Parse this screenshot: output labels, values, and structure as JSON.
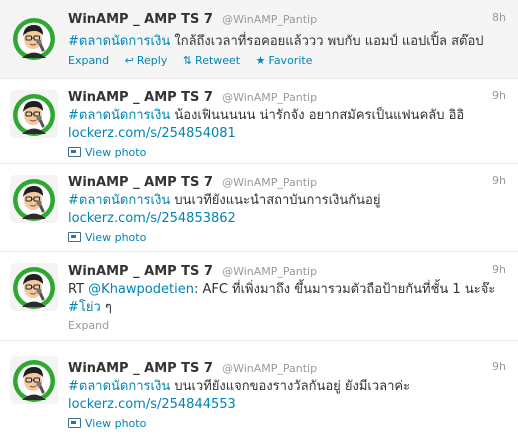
{
  "colors": {
    "link": "#0084b4",
    "muted": "#999999",
    "text": "#333333",
    "avatar_ring": "#2fa833"
  },
  "actions": {
    "expand": "Expand",
    "reply": "Reply",
    "retweet": "Retweet",
    "favorite": "Favorite",
    "view_photo": "View photo",
    "reply_icon": "reply-arrow-icon",
    "retweet_icon": "retweet-icon",
    "favorite_icon": "star-icon",
    "photo_icon": "photo-icon"
  },
  "tweets": [
    {
      "fullname": "WinAMP _ AMP TS 7",
      "username": "@WinAMP_Pantip",
      "time": "8h",
      "parts": [
        {
          "text": "#ตลาดนัดการเงิน",
          "link": true
        },
        {
          "text": " ใกล้ถึงเวลาที่รอคอยแล้ววว พบกับ แอมป์ แอปเปิ้ล สต๊อป",
          "link": false
        }
      ],
      "line2": ""
    },
    {
      "fullname": "WinAMP _ AMP TS 7",
      "username": "@WinAMP_Pantip",
      "time": "9h",
      "parts": [
        {
          "text": "#ตลาดนัดการเงิน",
          "link": true
        },
        {
          "text": " น้องเฟินนนนน น่ารักจัง อยากสมัครเป็นแฟนคลับ อิอิ",
          "link": false
        }
      ],
      "line2": "lockerz.com/s/254854081"
    },
    {
      "fullname": "WinAMP _ AMP TS 7",
      "username": "@WinAMP_Pantip",
      "time": "9h",
      "parts": [
        {
          "text": "#ตลาดนัดการเงิน",
          "link": true
        },
        {
          "text": " บนเวทียังแนะนำสถาบันการเงินกันอยู่",
          "link": false
        }
      ],
      "line2": "lockerz.com/s/254853862"
    },
    {
      "fullname": "WinAMP _ AMP TS 7",
      "username": "@WinAMP_Pantip",
      "time": "9h",
      "parts": [
        {
          "text": "RT ",
          "link": false
        },
        {
          "text": "@Khawpodetien",
          "link": true
        },
        {
          "text": ": AFC ที่เพิ่งมาถึง ขึ้นมารวมตัวถือป้ายกันที่ชั้น 1 นะจ๊ะ",
          "link": false
        }
      ],
      "line2_parts": [
        {
          "text": "#โย่ว",
          "link": true
        },
        {
          "text": " ๆ",
          "link": false
        }
      ]
    },
    {
      "fullname": "WinAMP _ AMP TS 7",
      "username": "@WinAMP_Pantip",
      "time": "9h",
      "parts": [
        {
          "text": "#ตลาดนัดการเงิน",
          "link": true
        },
        {
          "text": " บนเวทียังแจกของรางวัลกันอยู่ ยังมีเวลาค่ะ",
          "link": false
        }
      ],
      "line2": "lockerz.com/s/254844553"
    }
  ]
}
